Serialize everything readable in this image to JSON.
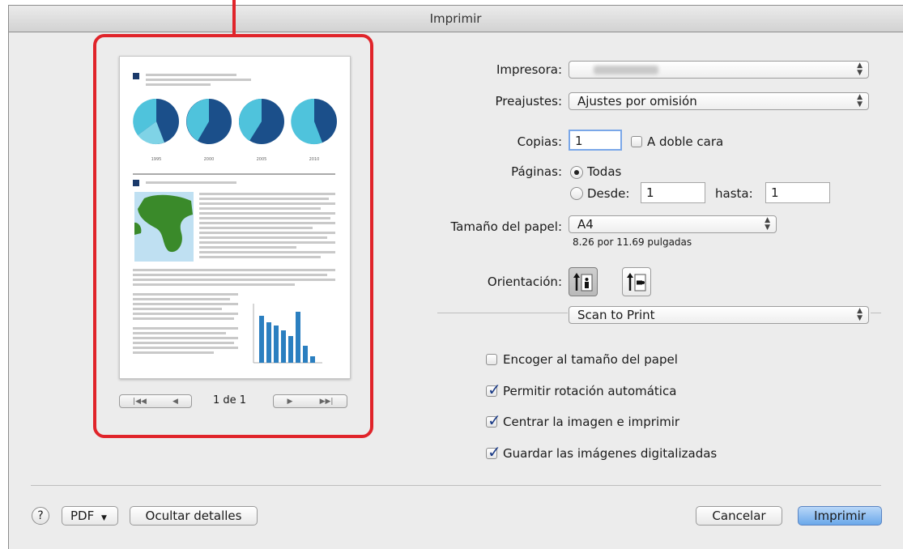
{
  "window": {
    "title": "Imprimir"
  },
  "preview": {
    "page_indicator": "1 de 1",
    "chart_year_labels": [
      "1995",
      "2000",
      "2005",
      "2010"
    ]
  },
  "settings": {
    "printer_label": "Impresora:",
    "printer_value": "",
    "presets_label": "Preajustes:",
    "presets_value": "Ajustes por omisión",
    "copies_label": "Copias:",
    "copies_value": "1",
    "two_sided_label": "A doble cara",
    "pages_label": "Páginas:",
    "pages_all_label": "Todas",
    "pages_from_label": "Desde:",
    "pages_from_value": "1",
    "pages_to_label": "hasta:",
    "pages_to_value": "1",
    "paper_size_label": "Tamaño del papel:",
    "paper_size_value": "A4",
    "paper_size_dims": "8.26 por 11.69 pulgadas",
    "orientation_label": "Orientación:",
    "section_value": "Scan to Print"
  },
  "options": [
    {
      "label": "Encoger al tamaño del papel",
      "checked": false
    },
    {
      "label": "Permitir rotación automática",
      "checked": true
    },
    {
      "label": "Centrar la imagen e imprimir",
      "checked": true
    },
    {
      "label": "Guardar las imágenes digitalizadas",
      "checked": true
    }
  ],
  "footer": {
    "help_label": "?",
    "pdf_label": "PDF",
    "hide_details_label": "Ocultar detalles",
    "cancel_label": "Cancelar",
    "print_label": "Imprimir"
  },
  "colors": {
    "callout": "#e0242a",
    "accent": "#6aa8ea",
    "pie_dark": "#1b4f8a",
    "pie_light": "#4fc3dc",
    "map_land": "#3a8a2a"
  }
}
